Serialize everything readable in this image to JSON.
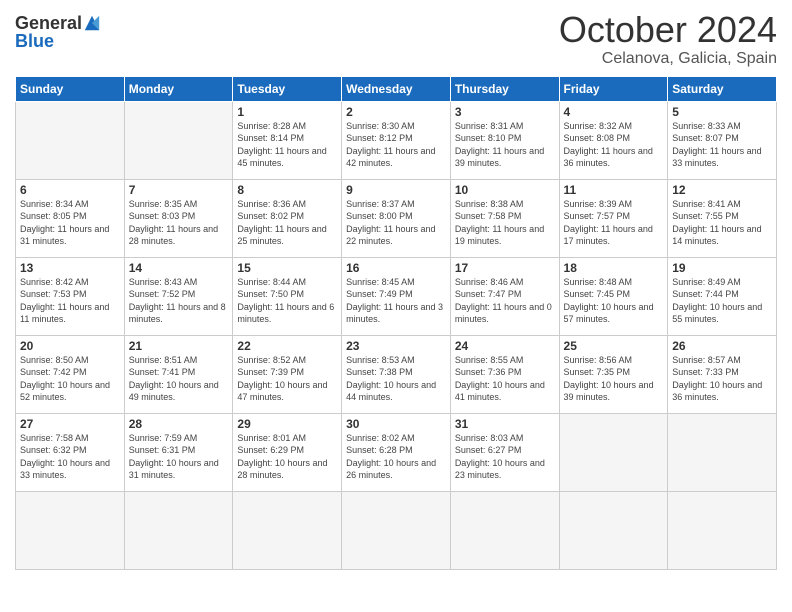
{
  "header": {
    "logo_general": "General",
    "logo_blue": "Blue",
    "month_title": "October 2024",
    "location": "Celanova, Galicia, Spain"
  },
  "weekdays": [
    "Sunday",
    "Monday",
    "Tuesday",
    "Wednesday",
    "Thursday",
    "Friday",
    "Saturday"
  ],
  "days": [
    {
      "num": "",
      "empty": true
    },
    {
      "num": "",
      "empty": true
    },
    {
      "num": "1",
      "sunrise": "8:28 AM",
      "sunset": "8:14 PM",
      "daylight": "11 hours and 45 minutes."
    },
    {
      "num": "2",
      "sunrise": "8:30 AM",
      "sunset": "8:12 PM",
      "daylight": "11 hours and 42 minutes."
    },
    {
      "num": "3",
      "sunrise": "8:31 AM",
      "sunset": "8:10 PM",
      "daylight": "11 hours and 39 minutes."
    },
    {
      "num": "4",
      "sunrise": "8:32 AM",
      "sunset": "8:08 PM",
      "daylight": "11 hours and 36 minutes."
    },
    {
      "num": "5",
      "sunrise": "8:33 AM",
      "sunset": "8:07 PM",
      "daylight": "11 hours and 33 minutes."
    },
    {
      "num": "6",
      "sunrise": "8:34 AM",
      "sunset": "8:05 PM",
      "daylight": "11 hours and 31 minutes."
    },
    {
      "num": "7",
      "sunrise": "8:35 AM",
      "sunset": "8:03 PM",
      "daylight": "11 hours and 28 minutes."
    },
    {
      "num": "8",
      "sunrise": "8:36 AM",
      "sunset": "8:02 PM",
      "daylight": "11 hours and 25 minutes."
    },
    {
      "num": "9",
      "sunrise": "8:37 AM",
      "sunset": "8:00 PM",
      "daylight": "11 hours and 22 minutes."
    },
    {
      "num": "10",
      "sunrise": "8:38 AM",
      "sunset": "7:58 PM",
      "daylight": "11 hours and 19 minutes."
    },
    {
      "num": "11",
      "sunrise": "8:39 AM",
      "sunset": "7:57 PM",
      "daylight": "11 hours and 17 minutes."
    },
    {
      "num": "12",
      "sunrise": "8:41 AM",
      "sunset": "7:55 PM",
      "daylight": "11 hours and 14 minutes."
    },
    {
      "num": "13",
      "sunrise": "8:42 AM",
      "sunset": "7:53 PM",
      "daylight": "11 hours and 11 minutes."
    },
    {
      "num": "14",
      "sunrise": "8:43 AM",
      "sunset": "7:52 PM",
      "daylight": "11 hours and 8 minutes."
    },
    {
      "num": "15",
      "sunrise": "8:44 AM",
      "sunset": "7:50 PM",
      "daylight": "11 hours and 6 minutes."
    },
    {
      "num": "16",
      "sunrise": "8:45 AM",
      "sunset": "7:49 PM",
      "daylight": "11 hours and 3 minutes."
    },
    {
      "num": "17",
      "sunrise": "8:46 AM",
      "sunset": "7:47 PM",
      "daylight": "11 hours and 0 minutes."
    },
    {
      "num": "18",
      "sunrise": "8:48 AM",
      "sunset": "7:45 PM",
      "daylight": "10 hours and 57 minutes."
    },
    {
      "num": "19",
      "sunrise": "8:49 AM",
      "sunset": "7:44 PM",
      "daylight": "10 hours and 55 minutes."
    },
    {
      "num": "20",
      "sunrise": "8:50 AM",
      "sunset": "7:42 PM",
      "daylight": "10 hours and 52 minutes."
    },
    {
      "num": "21",
      "sunrise": "8:51 AM",
      "sunset": "7:41 PM",
      "daylight": "10 hours and 49 minutes."
    },
    {
      "num": "22",
      "sunrise": "8:52 AM",
      "sunset": "7:39 PM",
      "daylight": "10 hours and 47 minutes."
    },
    {
      "num": "23",
      "sunrise": "8:53 AM",
      "sunset": "7:38 PM",
      "daylight": "10 hours and 44 minutes."
    },
    {
      "num": "24",
      "sunrise": "8:55 AM",
      "sunset": "7:36 PM",
      "daylight": "10 hours and 41 minutes."
    },
    {
      "num": "25",
      "sunrise": "8:56 AM",
      "sunset": "7:35 PM",
      "daylight": "10 hours and 39 minutes."
    },
    {
      "num": "26",
      "sunrise": "8:57 AM",
      "sunset": "7:33 PM",
      "daylight": "10 hours and 36 minutes."
    },
    {
      "num": "27",
      "sunrise": "7:58 AM",
      "sunset": "6:32 PM",
      "daylight": "10 hours and 33 minutes."
    },
    {
      "num": "28",
      "sunrise": "7:59 AM",
      "sunset": "6:31 PM",
      "daylight": "10 hours and 31 minutes."
    },
    {
      "num": "29",
      "sunrise": "8:01 AM",
      "sunset": "6:29 PM",
      "daylight": "10 hours and 28 minutes."
    },
    {
      "num": "30",
      "sunrise": "8:02 AM",
      "sunset": "6:28 PM",
      "daylight": "10 hours and 26 minutes."
    },
    {
      "num": "31",
      "sunrise": "8:03 AM",
      "sunset": "6:27 PM",
      "daylight": "10 hours and 23 minutes."
    },
    {
      "num": "",
      "empty": true
    },
    {
      "num": "",
      "empty": true
    },
    {
      "num": "",
      "empty": true
    }
  ]
}
